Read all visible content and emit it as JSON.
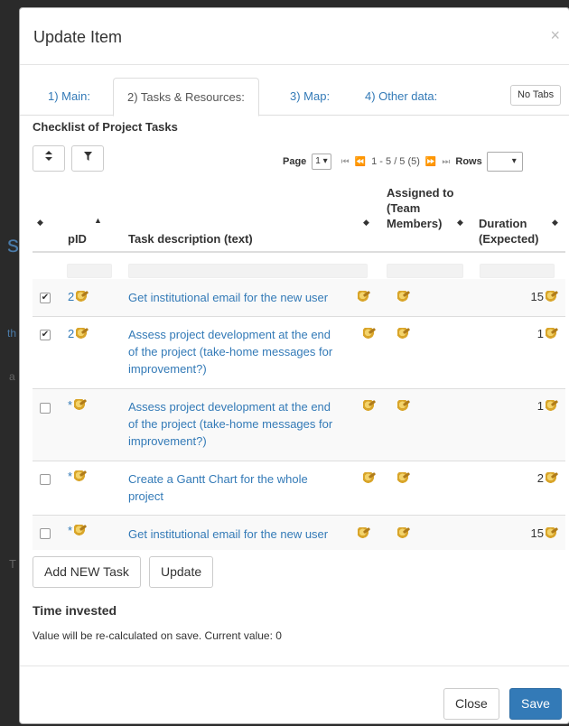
{
  "backdrop": {
    "frag_s": "s",
    "frag_th": "th",
    "frag_a": "a",
    "frag_t": "T"
  },
  "modal": {
    "title": "Update Item",
    "close_glyph": "×"
  },
  "tabs": [
    {
      "label": "1) Main:"
    },
    {
      "label": "2) Tasks & Resources:"
    },
    {
      "label": "3) Map:"
    },
    {
      "label": "4) Other data:"
    }
  ],
  "no_tabs_label": "No Tabs",
  "checklist": {
    "title": "Checklist of Project Tasks",
    "toolbar": {
      "sort_icon": "sort-icon",
      "filter_icon": "filter-icon"
    },
    "pager": {
      "page_label": "Page",
      "page_value": "1",
      "info": "1 - 5 / 5 (5)",
      "rows_label": "Rows",
      "rows_value": ""
    },
    "columns": {
      "pid": "pID",
      "desc": "Task description (text)",
      "assigned_1": "Assigned to",
      "assigned_2": "(Team",
      "assigned_3": "Members)",
      "duration_1": "Duration",
      "duration_2": "(Expected)"
    },
    "rows": [
      {
        "checked": true,
        "pid": "2",
        "desc": "Get institutional email for the new user",
        "duration": "15"
      },
      {
        "checked": true,
        "pid": "2",
        "desc": "Assess project development at the end of the project (take-home messages for improvement?)",
        "duration": "1"
      },
      {
        "checked": false,
        "pid": "*",
        "desc": "Assess project development at the end of the project (take-home messages for improvement?)",
        "duration": "1"
      },
      {
        "checked": false,
        "pid": "*",
        "desc": "Create a Gantt Chart for the whole project",
        "duration": "2"
      },
      {
        "checked": false,
        "pid": "*",
        "desc": "Get institutional email for the new user",
        "duration": "15"
      }
    ]
  },
  "buttons": {
    "add_task": "Add NEW Task",
    "update": "Update"
  },
  "time": {
    "title": "Time invested",
    "text": "Value will be re-calculated on save. Current value: 0"
  },
  "footer": {
    "close": "Close",
    "save": "Save"
  },
  "colors": {
    "link": "#337ab7",
    "primary": "#337ab7"
  }
}
